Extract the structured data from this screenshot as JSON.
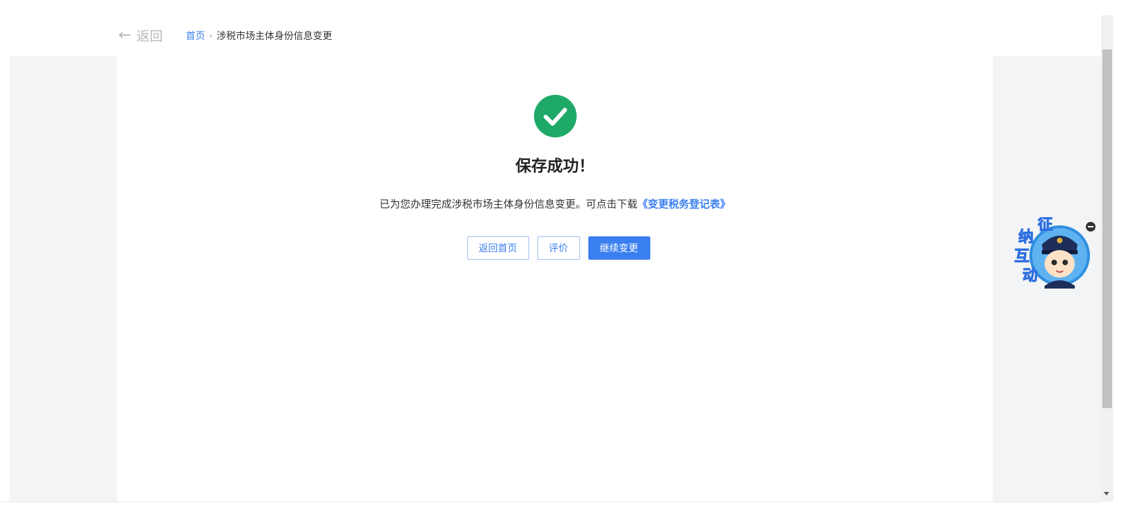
{
  "header": {
    "back_label": "返回",
    "breadcrumb": {
      "home": "首页",
      "separator": "›",
      "current": "涉税市场主体身份信息变更"
    }
  },
  "result": {
    "icon": "check-circle-icon",
    "status_color": "#1fa968",
    "title": "保存成功！",
    "message_prefix": "已为您办理完成涉税市场主体身份信息变更。可点击下载",
    "download_link": "《变更税务登记表》"
  },
  "actions": {
    "back_home_label": "返回首页",
    "evaluate_label": "评价",
    "continue_label": "继续变更"
  },
  "assistant": {
    "icon": "tax-officer-avatar-icon",
    "label_chars": [
      "征",
      "纳",
      "互",
      "动"
    ],
    "close_icon": "minus-circle-icon"
  },
  "colors": {
    "accent": "#3a7ff0",
    "page_background": "#f3f4f6"
  }
}
